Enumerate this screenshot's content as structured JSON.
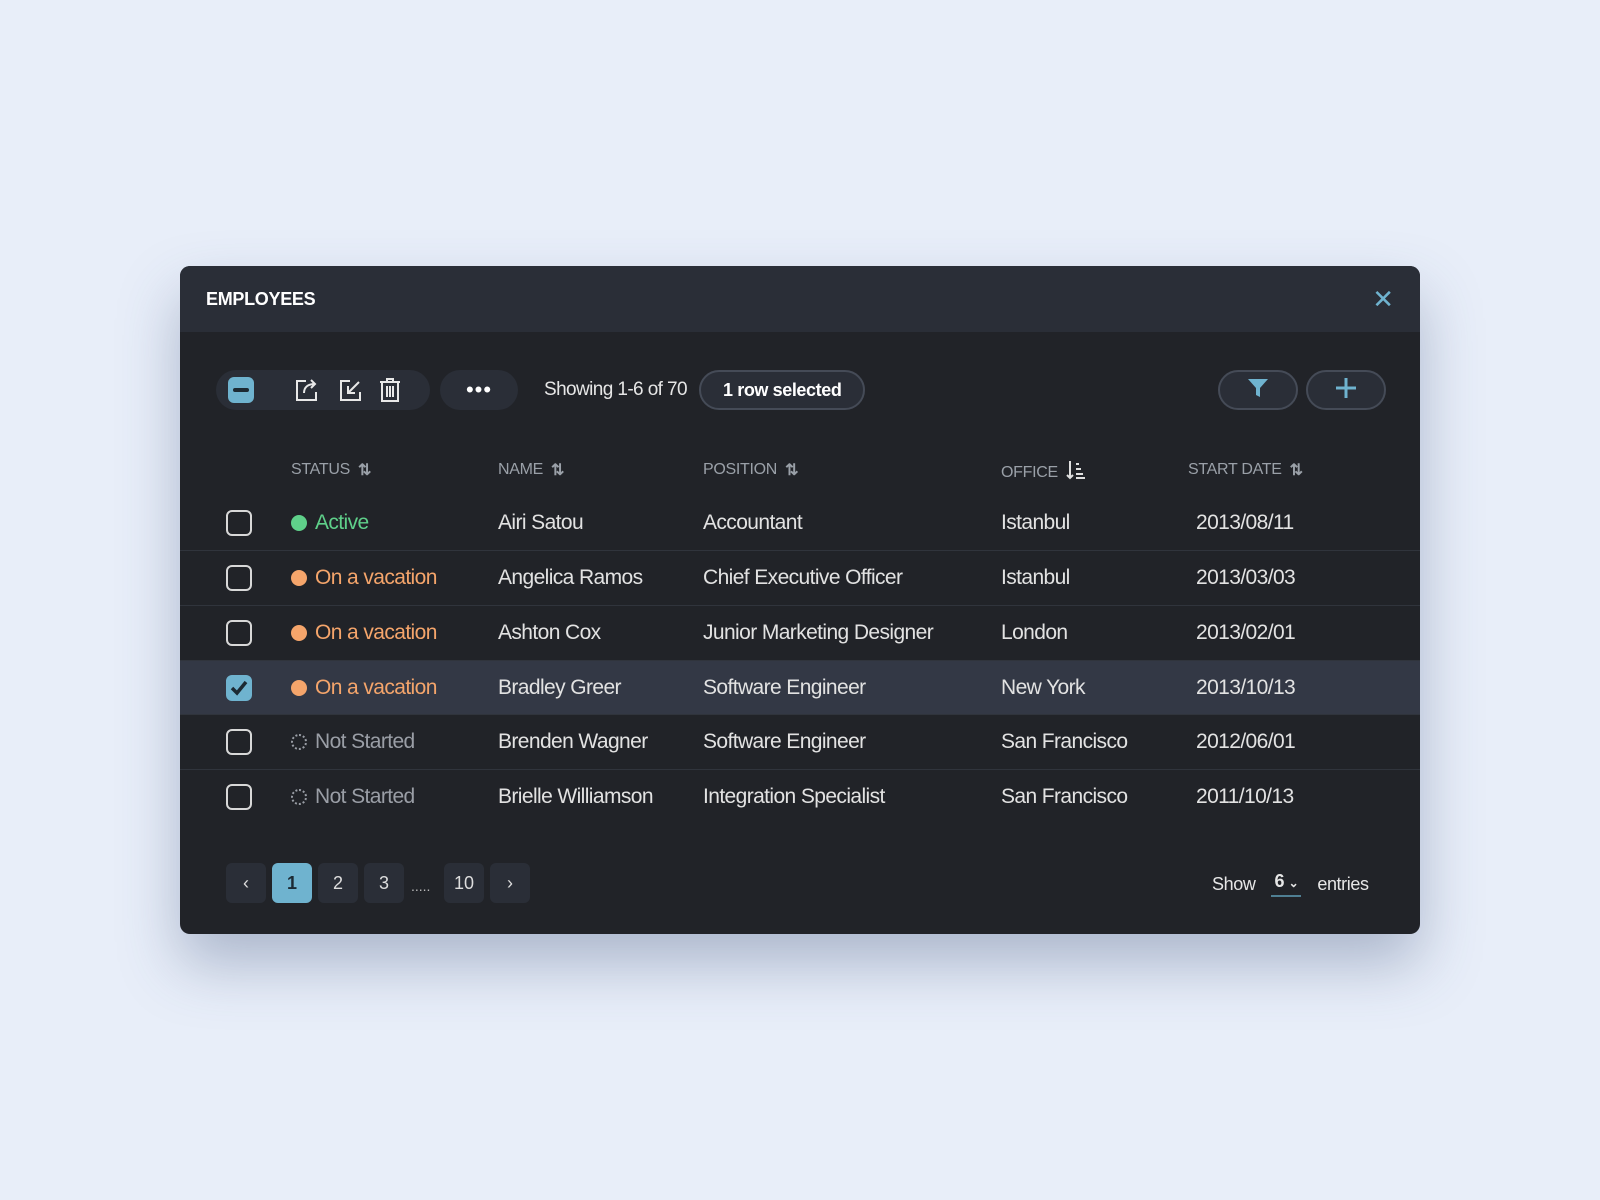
{
  "title": "EMPLOYEES",
  "toolbar": {
    "showing": "Showing 1-6 of 70",
    "selected": "1 row selected",
    "more": "•••"
  },
  "columns": [
    "STATUS",
    "NAME",
    "POSITION",
    "OFFICE",
    "START DATE"
  ],
  "colors": {
    "active": "#5fd08a",
    "vacation": "#f5a56b",
    "not_started": "#9a9ea6",
    "accent": "#6fb3cf"
  },
  "rows": [
    {
      "status": "Active",
      "name": "Airi Satou",
      "position": "Accountant",
      "office": "Istanbul",
      "date": "2013/08/11",
      "checked": false
    },
    {
      "status": "On a vacation",
      "name": "Angelica Ramos",
      "position": "Chief Executive Officer",
      "office": "Istanbul",
      "date": "2013/03/03",
      "checked": false
    },
    {
      "status": "On a vacation",
      "name": "Ashton Cox",
      "position": "Junior Marketing Designer",
      "office": "London",
      "date": "2013/02/01",
      "checked": false
    },
    {
      "status": "On a vacation",
      "name": "Bradley Greer",
      "position": "Software Engineer",
      "office": "New York",
      "date": "2013/10/13",
      "checked": true
    },
    {
      "status": "Not Started",
      "name": "Brenden Wagner",
      "position": "Software Engineer",
      "office": "San Francisco",
      "date": "2012/06/01",
      "checked": false
    },
    {
      "status": "Not Started",
      "name": "Brielle Williamson",
      "position": "Integration Specialist",
      "office": "San Francisco",
      "date": "2011/10/13",
      "checked": false
    }
  ],
  "pagination": {
    "pages": [
      "1",
      "2",
      "3",
      "10"
    ],
    "ellipsis": ".....",
    "current": "1"
  },
  "entries": {
    "show": "Show",
    "value": "6",
    "suffix": "entries"
  }
}
